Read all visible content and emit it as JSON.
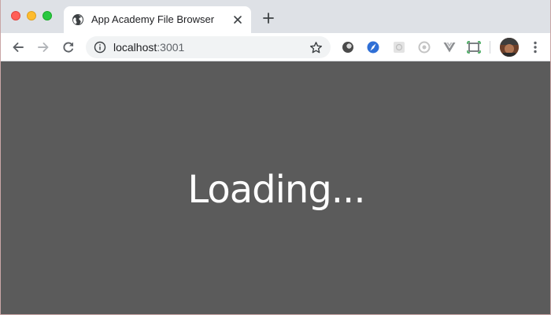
{
  "window": {
    "controls": [
      "close",
      "minimize",
      "maximize"
    ]
  },
  "tab": {
    "title": "App Academy File Browser",
    "favicon": "globe-icon"
  },
  "toolbar": {
    "url_host": "localhost",
    "url_port": ":3001",
    "extensions": [
      "extension-dark-circle-icon",
      "extension-blue-compass-icon",
      "extension-grid-icon",
      "extension-ring-icon",
      "extension-vue-icon",
      "extension-screenshot-icon"
    ]
  },
  "page": {
    "message": "Loading..."
  },
  "colors": {
    "page_background": "#5b5b5b",
    "message_text": "#ffffff",
    "tabstrip": "#dee1e6"
  }
}
